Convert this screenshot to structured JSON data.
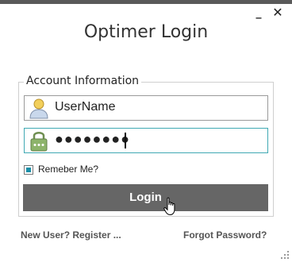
{
  "window": {
    "minimize_glyph": "_",
    "close_glyph": "✕"
  },
  "title": "Optimer Login",
  "group": {
    "legend": "Account Information"
  },
  "username": {
    "value": "UserName",
    "icon": "user-icon"
  },
  "password": {
    "value": "●●●●●●●●",
    "icon": "lock-icon"
  },
  "remember": {
    "label": "Remeber Me?",
    "checked": true
  },
  "login_button": {
    "label": "Login"
  },
  "links": {
    "new_user": "New User? Register ...",
    "forgot": "Forgot Password?"
  },
  "colors": {
    "button": "#666666",
    "focus_border": "#3fa9b3",
    "check_fill": "#1a8fa8",
    "lock_icon": "#7aa25a",
    "user_icon": "#e8c14a"
  }
}
